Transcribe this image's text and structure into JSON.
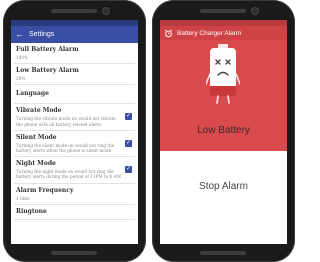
{
  "settings_screen": {
    "title": "Settings",
    "items": [
      {
        "title": "Full Battery Alarm",
        "subtitle": "100%"
      },
      {
        "title": "Low Battery Alarm",
        "subtitle": "20%"
      },
      {
        "title": "Language",
        "subtitle": ""
      },
      {
        "title": "Vibrate Mode",
        "subtitle": "Turning the vibrate mode on would not vibrate the phone with all battery related alerts",
        "checked": true
      },
      {
        "title": "Silent Mode",
        "subtitle": "Turning the silent mode on would not ring the battery alerts when the phone is silent mode.",
        "checked": true
      },
      {
        "title": "Night Mode",
        "subtitle": "Turning the night mode on would not ring the battery alerts during the period of 11PM to 6 AM",
        "checked": true
      },
      {
        "title": "Alarm Frequency",
        "subtitle": "1 time"
      },
      {
        "title": "Ringtone",
        "subtitle": ""
      }
    ]
  },
  "alarm_screen": {
    "title": "Battery Charger Alarm",
    "status_text": "Low Battery",
    "stop_label": "Stop Alarm"
  },
  "colors": {
    "settings_primary": "#3a4ea6",
    "alarm_primary": "#d94a4d"
  }
}
